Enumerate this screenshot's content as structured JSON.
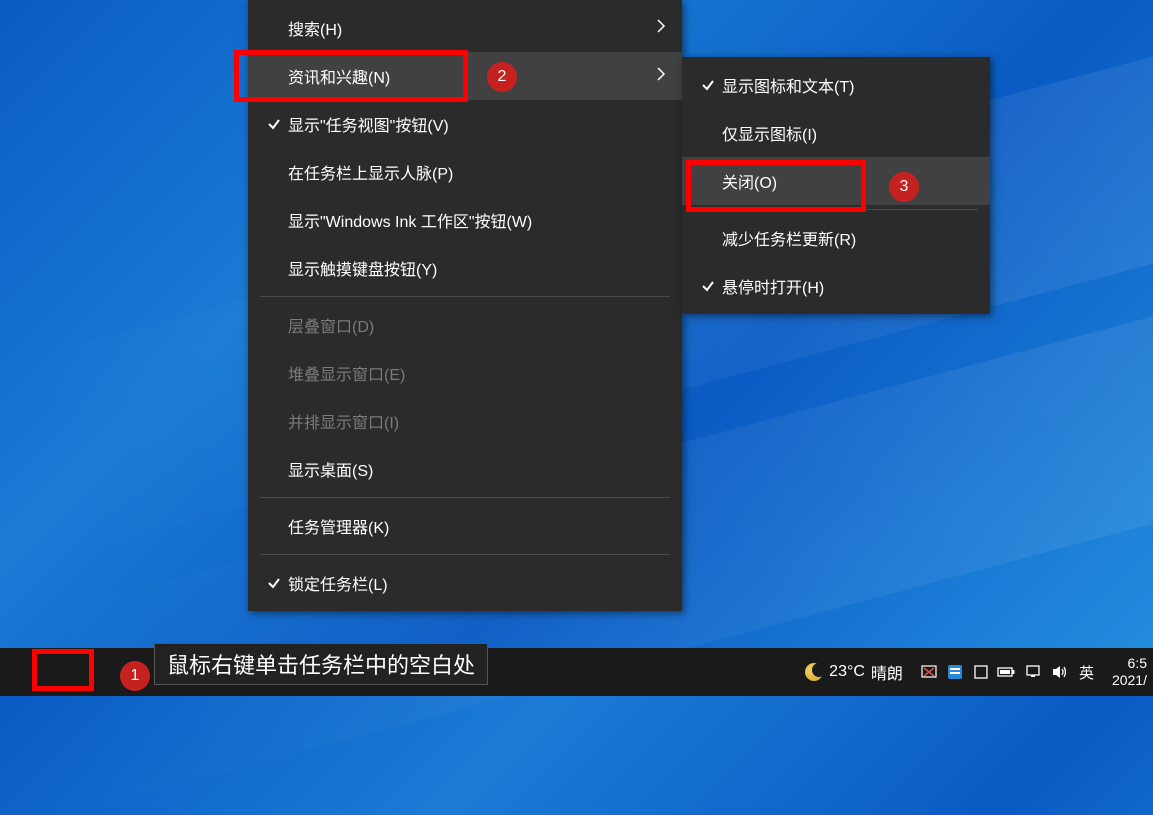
{
  "mainMenu": {
    "items": [
      {
        "label": "搜索(H)",
        "checked": false,
        "arrow": true,
        "disabled": false
      },
      {
        "label": "资讯和兴趣(N)",
        "checked": false,
        "arrow": true,
        "disabled": false,
        "highlighted": true
      },
      {
        "label": "显示\"任务视图\"按钮(V)",
        "checked": true,
        "arrow": false,
        "disabled": false
      },
      {
        "label": "在任务栏上显示人脉(P)",
        "checked": false,
        "arrow": false,
        "disabled": false
      },
      {
        "label": "显示\"Windows Ink 工作区\"按钮(W)",
        "checked": false,
        "arrow": false,
        "disabled": false
      },
      {
        "label": "显示触摸键盘按钮(Y)",
        "checked": false,
        "arrow": false,
        "disabled": false
      },
      {
        "sep": true
      },
      {
        "label": "层叠窗口(D)",
        "checked": false,
        "arrow": false,
        "disabled": true
      },
      {
        "label": "堆叠显示窗口(E)",
        "checked": false,
        "arrow": false,
        "disabled": true
      },
      {
        "label": "并排显示窗口(I)",
        "checked": false,
        "arrow": false,
        "disabled": true
      },
      {
        "label": "显示桌面(S)",
        "checked": false,
        "arrow": false,
        "disabled": false
      },
      {
        "sep": true
      },
      {
        "label": "任务管理器(K)",
        "checked": false,
        "arrow": false,
        "disabled": false
      },
      {
        "sep": true
      },
      {
        "label": "锁定任务栏(L)",
        "checked": true,
        "arrow": false,
        "disabled": false
      }
    ]
  },
  "subMenu": {
    "items": [
      {
        "label": "显示图标和文本(T)",
        "checked": true
      },
      {
        "label": "仅显示图标(I)",
        "checked": false
      },
      {
        "label": "关闭(O)",
        "checked": false,
        "highlighted": true
      },
      {
        "sep": true
      },
      {
        "label": "减少任务栏更新(R)",
        "checked": false
      },
      {
        "label": "悬停时打开(H)",
        "checked": true
      }
    ]
  },
  "tooltip": "鼠标右键单击任务栏中的空白处",
  "weather": {
    "temp": "23°C",
    "cond": "晴朗"
  },
  "clock": {
    "time": "6:5",
    "date": "2021/"
  },
  "ime": "英",
  "steps": {
    "s1": "1",
    "s2": "2",
    "s3": "3"
  }
}
